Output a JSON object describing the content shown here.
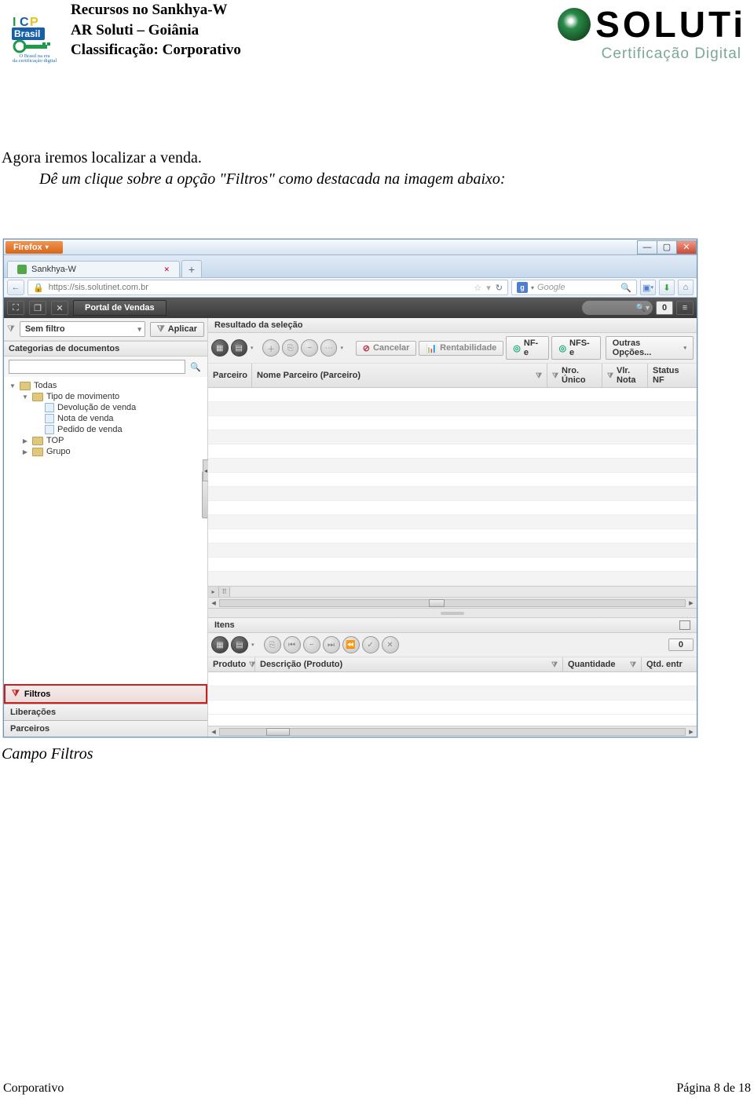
{
  "header": {
    "line1": "Recursos no Sankhya-W",
    "line2": "AR Soluti – Goiânia",
    "line3": "Classificação: Corporativo",
    "icp": {
      "top": "ICP",
      "bottom": "Brasil",
      "tag1": "O Brasil na era",
      "tag2": "da certificação digital"
    },
    "soluti": {
      "name": "SOLUTi",
      "sub": "Certificação Digital"
    }
  },
  "body": {
    "p1": "Agora iremos localizar a venda.",
    "p2": "Dê um clique sobre a opção \"Filtros\" como destacada na imagem abaixo:"
  },
  "app": {
    "firefox": "Firefox",
    "tab_title": "Sankhya-W",
    "new_tab_plus": "+",
    "url": "https://sis.solutinet.com.br",
    "search_placeholder": "Google",
    "portal_tab": "Portal de Vendas",
    "dark_zero": "0",
    "left": {
      "filter_value": "Sem filtro",
      "apply": "Aplicar",
      "cat_header": "Categorias de documentos",
      "tree": {
        "n0": "Todas",
        "n1": "Tipo de movimento",
        "n1a": "Devolução de venda",
        "n1b": "Nota de venda",
        "n1c": "Pedido de venda",
        "n2": "TOP",
        "n3": "Grupo"
      },
      "side": {
        "filtros": "Filtros",
        "liberacoes": "Liberações",
        "parceiros": "Parceiros"
      }
    },
    "right": {
      "sel_header": "Resultado da seleção",
      "btn_cancel": "Cancelar",
      "btn_rent": "Rentabilidade",
      "btn_nfe": "NF-e",
      "btn_nfse": "NFS-e",
      "btn_outras": "Outras Opções...",
      "cols": {
        "c1": "Parceiro",
        "c2": "Nome Parceiro (Parceiro)",
        "c3": "Nro. Único",
        "c4": "Vlr. Nota",
        "c5": "Status NF"
      },
      "itens_header": "Itens",
      "itens_zero": "0",
      "icols": {
        "c1": "Produto",
        "c2": "Descrição (Produto)",
        "c3": "Quantidade",
        "c4": "Qtd. entr"
      }
    }
  },
  "caption": "Campo Filtros",
  "footer": {
    "left": "Corporativo",
    "right_prefix": "Página ",
    "page": "8",
    "right_mid": " de ",
    "total": "18"
  }
}
